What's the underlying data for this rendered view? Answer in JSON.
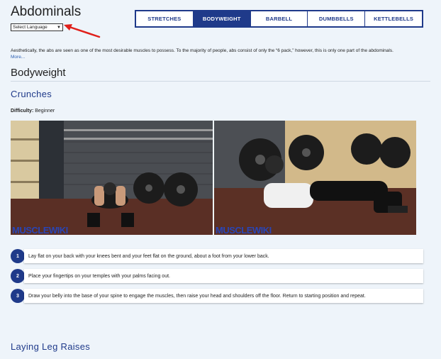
{
  "page": {
    "title": "Abdominals",
    "language_select": "Select Language",
    "intro": "Aesthetically, the abs are seen as one of the most desirable muscles to possess. To the majority of people, abs consist of only the “6 pack,” however, this is only one part of the abdominals.",
    "more_link": "More..."
  },
  "tabs": [
    {
      "label": "STRETCHES",
      "active": false
    },
    {
      "label": "BODYWEIGHT",
      "active": true
    },
    {
      "label": "BARBELL",
      "active": false
    },
    {
      "label": "DUMBBELLS",
      "active": false
    },
    {
      "label": "KETTLEBELLS",
      "active": false
    }
  ],
  "section": {
    "title": "Bodyweight"
  },
  "exercises": [
    {
      "name": "Crunches",
      "difficulty_label": "Difficulty:",
      "difficulty_value": "Beginner",
      "watermark": "MUSCLEWIKI",
      "steps": [
        {
          "n": "1",
          "text": "Lay flat on your back with your knees bent and your feet flat on the ground, about a foot from your lower back."
        },
        {
          "n": "2",
          "text": "Place your fingertips on your temples with your palms facing out."
        },
        {
          "n": "3",
          "text": "Draw your belly into the base of your spine to engage the muscles, then raise your head and shoulders off the floor. Return to starting position and repeat."
        }
      ]
    },
    {
      "name": "Laying Leg Raises"
    }
  ],
  "colors": {
    "accent": "#1f3a8a",
    "background": "#eef4fa",
    "link": "#2b5fb3",
    "arrow": "#e0201b"
  }
}
